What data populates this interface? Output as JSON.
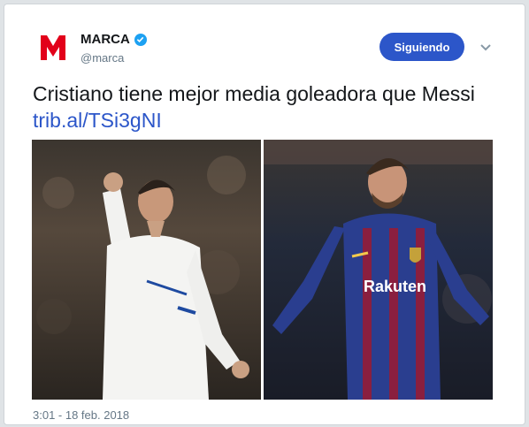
{
  "account": {
    "display_name": "MARCA",
    "handle": "@marca",
    "logo_letter": "M",
    "logo_color": "#e2001a",
    "verified": true
  },
  "follow_button": {
    "label": "Siguiendo",
    "color": "#2c56c9"
  },
  "menu": {
    "icon": "chevron-down-icon"
  },
  "tweet": {
    "text": "Cristiano tiene mejor media goleadora que Messi",
    "link_text": "trib.al/TSi3gNI",
    "link_color": "#2c56c9"
  },
  "media": {
    "photos": [
      {
        "subject": "Real Madrid player in white kit raising fist"
      },
      {
        "subject": "FC Barcelona player in blue-garnet kit"
      }
    ],
    "jersey_sponsor": "Rakuten"
  },
  "timestamp": "3:01 - 18 feb. 2018"
}
